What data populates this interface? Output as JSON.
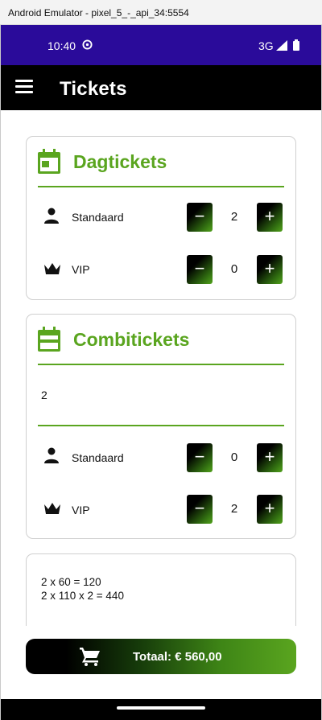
{
  "window": {
    "title": "Android Emulator - pixel_5_-_api_34:5554"
  },
  "status_bar": {
    "time": "10:40",
    "network": "3G"
  },
  "app_bar": {
    "title": "Tickets"
  },
  "dagtickets": {
    "title": "Dagtickets",
    "rows": [
      {
        "label": "Standaard",
        "qty": "2"
      },
      {
        "label": "VIP",
        "qty": "0"
      }
    ]
  },
  "combitickets": {
    "title": "Combitickets",
    "count": "2",
    "rows": [
      {
        "label": "Standaard",
        "qty": "0"
      },
      {
        "label": "VIP",
        "qty": "2"
      }
    ]
  },
  "summary": {
    "lines": [
      "2 x 60 = 120",
      "2 x 110 x 2 = 440"
    ]
  },
  "total": {
    "label": "Totaal: € 560,00"
  },
  "buttons": {
    "minus": "−",
    "plus": "+"
  },
  "colors": {
    "accent": "#5aa51f",
    "status_bar": "#2a0b9a",
    "app_bar": "#000000"
  }
}
